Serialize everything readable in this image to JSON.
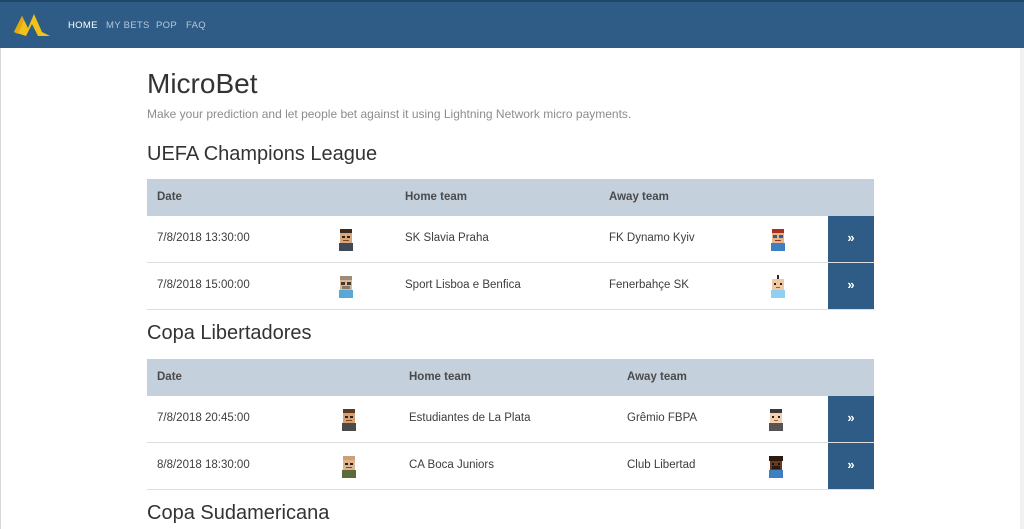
{
  "nav": {
    "links": [
      "HOME",
      "MY BETS",
      "POP",
      "FAQ"
    ],
    "active": "HOME",
    "brand_color": "#2e5c86",
    "logo_icon": "lightning-m-logo"
  },
  "page": {
    "title": "MicroBet",
    "subtitle": "Make your prediction and let people bet against it using Lightning Network micro payments."
  },
  "columns": {
    "date": "Date",
    "home": "Home team",
    "away": "Away team"
  },
  "leagues": [
    {
      "name": "UEFA Champions League",
      "matches": [
        {
          "date": "7/8/2018 13:30:00",
          "home": "SK Slavia Praha",
          "away": "FK Dynamo Kyiv",
          "action": "»"
        },
        {
          "date": "7/8/2018 15:00:00",
          "home": "Sport Lisboa e Benfica",
          "away": "Fenerbahçe SK",
          "action": "»"
        }
      ]
    },
    {
      "name": "Copa Libertadores",
      "matches": [
        {
          "date": "7/8/2018 20:45:00",
          "home": "Estudiantes de La Plata",
          "away": "Grêmio FBPA",
          "action": "»"
        },
        {
          "date": "8/8/2018 18:30:00",
          "home": "CA Boca Juniors",
          "away": "Club Libertad",
          "action": "»"
        }
      ]
    },
    {
      "name": "Copa Sudamericana",
      "matches": []
    }
  ]
}
